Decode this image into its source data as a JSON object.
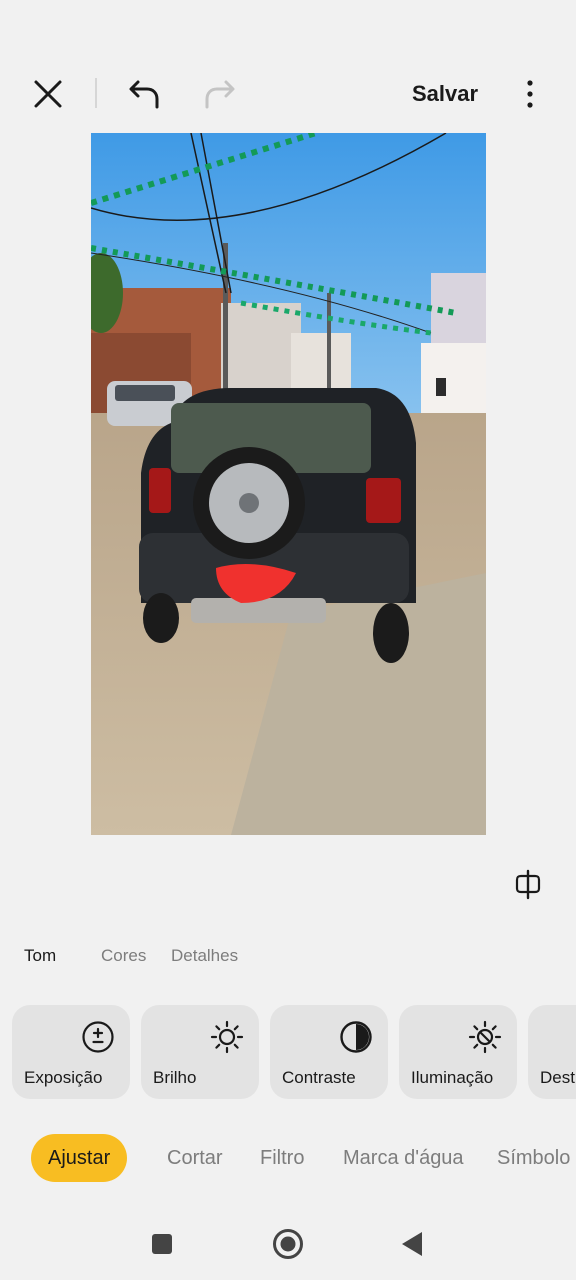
{
  "toolbar": {
    "save_label": "Salvar",
    "icons": [
      "close-icon",
      "undo-icon",
      "redo-icon",
      "more-vert-icon"
    ]
  },
  "photo": {
    "description_icon": "photo-car-street"
  },
  "sub_tabs": [
    {
      "label": "Tom",
      "active": true
    },
    {
      "label": "Cores",
      "active": false
    },
    {
      "label": "Detalhes",
      "active": false
    }
  ],
  "tools": [
    {
      "label": "Exposição",
      "icon": "exposure-icon"
    },
    {
      "label": "Brilho",
      "icon": "brightness-icon"
    },
    {
      "label": "Contraste",
      "icon": "contrast-icon"
    },
    {
      "label": "Iluminação",
      "icon": "highlights-icon"
    },
    {
      "label": "Dest",
      "icon": "unknown-icon"
    }
  ],
  "main_tabs": [
    {
      "label": "Ajustar",
      "active": true
    },
    {
      "label": "Cortar",
      "active": false
    },
    {
      "label": "Filtro",
      "active": false
    },
    {
      "label": "Marca d'água",
      "active": false
    },
    {
      "label": "Símbolo",
      "active": false
    }
  ],
  "colors": {
    "accent": "#f8bd22",
    "background": "#f1f1f1",
    "card": "#e3e3e3"
  }
}
